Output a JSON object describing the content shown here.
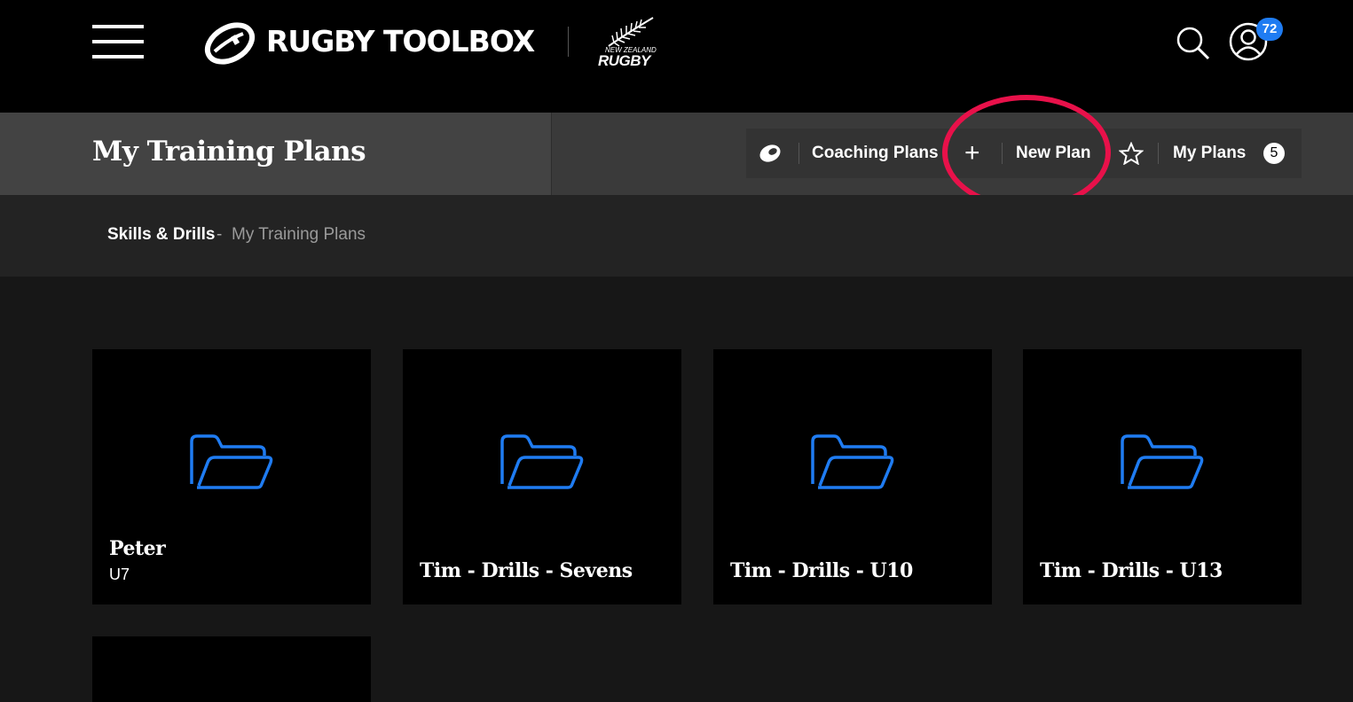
{
  "header": {
    "brand": "RUGBY TOOLBOX",
    "partner_small": "NEW ZEALAND",
    "partner_big": "RUGBY",
    "notification_count": "72"
  },
  "subheader": {
    "title": "My Training Plans",
    "coaching_plans": "Coaching Plans",
    "new_plan": "New Plan",
    "my_plans": "My Plans",
    "my_plans_count": "5"
  },
  "breadcrumb": {
    "parent": "Skills & Drills",
    "separator": "-",
    "current": "My Training Plans"
  },
  "plans": [
    {
      "title": "Peter",
      "subtitle": "U7"
    },
    {
      "title": "Tim - Drills - Sevens",
      "subtitle": ""
    },
    {
      "title": "Tim - Drills - U10",
      "subtitle": ""
    },
    {
      "title": "Tim - Drills - U13",
      "subtitle": ""
    }
  ],
  "colors": {
    "accent_blue": "#1f7cf2",
    "highlight": "#e8114a"
  },
  "icons": [
    "menu-icon",
    "rugby-ball-icon",
    "silver-fern-icon",
    "search-icon",
    "user-icon",
    "plus-icon",
    "star-icon",
    "folder-icon"
  ]
}
